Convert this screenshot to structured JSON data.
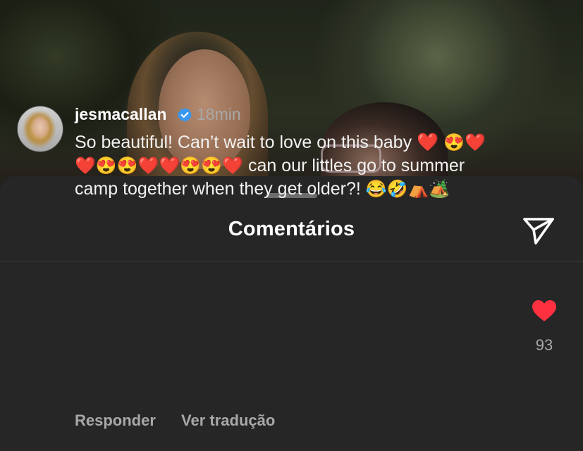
{
  "sheet": {
    "title": "Comentários"
  },
  "icons": {
    "share": "paper-plane-icon",
    "verified": "verified-badge-icon",
    "like": "heart-icon"
  },
  "colors": {
    "background": "#262626",
    "like": "#ff3040",
    "verified": "#3897f0",
    "secondary_text": "#a8a8a8"
  },
  "comment": {
    "username": "jesmacallan",
    "time": "18min",
    "text_part1": "So beautiful! Can’t wait to love on this baby ❤️",
    "text_part2": "😍❤️❤️😍😍❤️❤️😍😍❤️",
    "text_part3": " can our littles go to summer camp together when they get older?! ",
    "text_part4": "😂🤣⛺🏕️",
    "like_count": "93",
    "reply_label": "Responder",
    "translate_label": "Ver tradução"
  }
}
